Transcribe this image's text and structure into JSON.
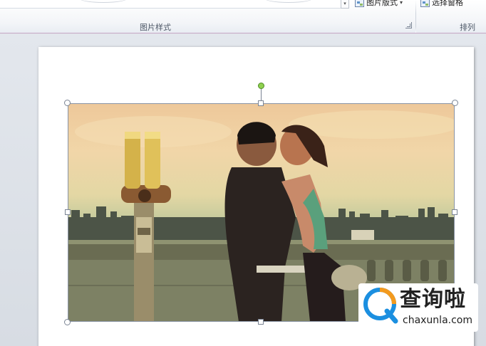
{
  "ribbon": {
    "picture_layout_label": "图片版式",
    "selection_pane_label": "选择窗格",
    "picture_styles_group": "图片样式",
    "arrange_group": "排列"
  },
  "watermark": {
    "text": "查询啦",
    "domain": "chaxunla.com"
  },
  "colors": {
    "rotate_handle": "#8fd14f",
    "selection_border": "#8a94a5",
    "ribbon_accent": "#c8a9c7",
    "watermark_orange": "#f39a1e",
    "watermark_blue": "#1b8fe0"
  },
  "icons": [
    "picture-layout-icon",
    "selection-pane-icon",
    "dialog-launcher-icon",
    "rotate-handle-icon",
    "watermark-logo-icon"
  ]
}
